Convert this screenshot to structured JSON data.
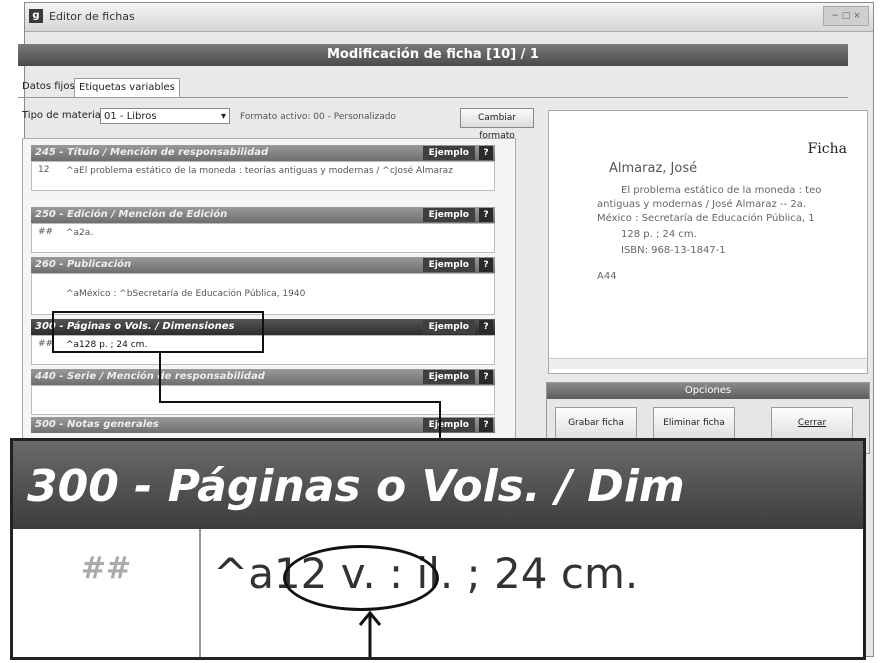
{
  "window": {
    "title": "Editor de fichas",
    "controls": "− □ ×"
  },
  "header": {
    "title": "Modificación de ficha [10] / 1"
  },
  "tabs": [
    {
      "label": "Datos fijos"
    },
    {
      "label": "Etiquetas variables"
    }
  ],
  "material": {
    "label": "Tipo de material:",
    "value": "01 - Libros",
    "format_label": "Formato activo: 00 - Personalizado",
    "change_button": "Cambiar formato"
  },
  "fields": [
    {
      "head": "245 - Título / Mención de responsabilidad",
      "ind": "12",
      "value": "^aEl problema estático de la moneda : teorías antiguas y modernas / ^cJosé Almaraz"
    },
    {
      "head": "250 - Edición / Mención de Edición",
      "ind": "##",
      "value": "^a2a."
    },
    {
      "head": "260 - Publicación",
      "ind": "",
      "value": "^aMéxico : ^bSecretaría de Educación Pública, 1940"
    },
    {
      "head": "300 - Páginas o Vols. / Dimensiones",
      "ind": "##",
      "value": "^a128 p. ; 24 cm."
    },
    {
      "head": "440 - Serie / Mención de responsabilidad",
      "ind": "",
      "value": ""
    },
    {
      "head": "500 - Notas generales",
      "ind": "",
      "value": ""
    }
  ],
  "example_label": "Ejemplo",
  "help_label": "?",
  "card": {
    "title": "Ficha",
    "author": "Almaraz, José",
    "lines": [
      "El problema estático de la moneda : teo",
      "antiguas y modernas / José Almaraz -- 2a.",
      "México : Secretaría de Educación Pública, 1",
      "128 p. ; 24 cm.",
      "ISBN: 968-13-1847-1",
      "A44"
    ]
  },
  "options": {
    "title": "Opciones",
    "buttons": [
      "Grabar ficha",
      "Eliminar ficha",
      "Cerrar"
    ]
  },
  "zoom": {
    "head": "300 - Páginas o Vols. / Dim",
    "ind": "##",
    "value": "^a12 v. : il.  ; 24 cm."
  }
}
